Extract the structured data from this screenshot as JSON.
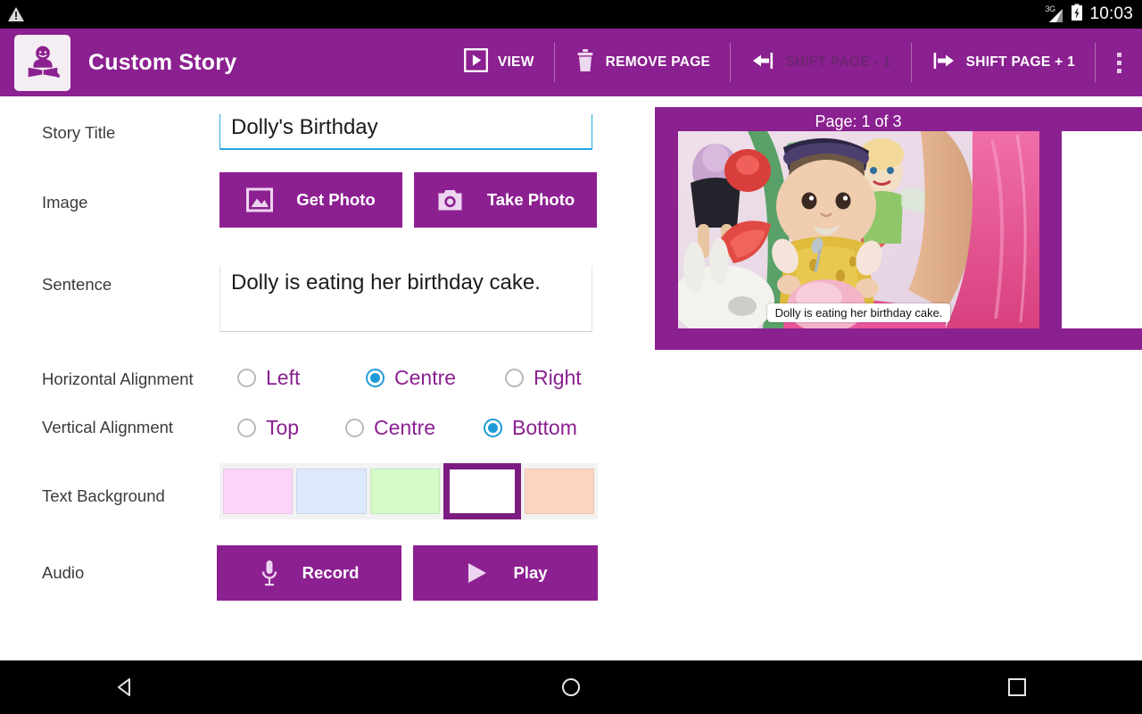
{
  "status_bar": {
    "warning_icon": "warning-triangle-icon",
    "network_label": "3G",
    "signal_icon": "signal-bars-icon",
    "battery_icon": "battery-charging-icon",
    "time": "10:03"
  },
  "app_bar": {
    "logo_icon": "girl-reading-book-icon",
    "title": "Custom Story",
    "actions": [
      {
        "label": "VIEW",
        "icon": "play-boxed-icon",
        "enabled": true
      },
      {
        "label": "REMOVE PAGE",
        "icon": "trash-icon",
        "enabled": true
      },
      {
        "label": "SHIFT PAGE - 1",
        "icon": "arrow-left-bar-icon",
        "enabled": false
      },
      {
        "label": "SHIFT PAGE + 1",
        "icon": "arrow-right-bar-icon",
        "enabled": true
      }
    ],
    "overflow_icon": "more-vertical-icon"
  },
  "form": {
    "story_title": {
      "label": "Story Title",
      "value": "Dolly's Birthday",
      "placeholder": "Story Title"
    },
    "image": {
      "label": "Image",
      "get_photo_label": "Get Photo",
      "get_photo_icon": "picture-icon",
      "take_photo_label": "Take Photo",
      "take_photo_icon": "camera-icon"
    },
    "sentence": {
      "label": "Sentence",
      "value": "Dolly is eating her birthday cake.",
      "placeholder": "Sentence"
    },
    "horizontal_alignment": {
      "label": "Horizontal Alignment",
      "selected": "Centre",
      "options": [
        "Left",
        "Centre",
        "Right"
      ]
    },
    "vertical_alignment": {
      "label": "Vertical Alignment",
      "selected": "Bottom",
      "options": [
        "Top",
        "Centre",
        "Bottom"
      ]
    },
    "text_background": {
      "label": "Text Background",
      "selected_index": 3,
      "swatches": [
        {
          "name": "pink",
          "color": "#FBD4F7"
        },
        {
          "name": "blue",
          "color": "#DCE8FB"
        },
        {
          "name": "green",
          "color": "#D4FBC8"
        },
        {
          "name": "white",
          "color": "#FFFFFF"
        },
        {
          "name": "peach",
          "color": "#FCD6C0"
        }
      ],
      "selected_border_color": "#7B1C80"
    },
    "audio": {
      "label": "Audio",
      "record_label": "Record",
      "record_icon": "microphone-icon",
      "play_label": "Play",
      "play_icon": "play-triangle-icon"
    }
  },
  "preview": {
    "page_indicator": "Page: 1 of 3",
    "caption": "Dolly is eating her birthday cake.",
    "photo_alt": "doll-photo"
  },
  "nav_bar": {
    "back_icon": "back-triangle-icon",
    "home_icon": "home-circle-icon",
    "recents_icon": "recents-square-icon"
  },
  "theme": {
    "primary": "#8B2090",
    "button": "#8D2091",
    "accent_blue": "#1E9BD7",
    "focus_underline": "#29A8E0",
    "label_text": "#3B3B3B",
    "radio_label": "#8B2090"
  }
}
